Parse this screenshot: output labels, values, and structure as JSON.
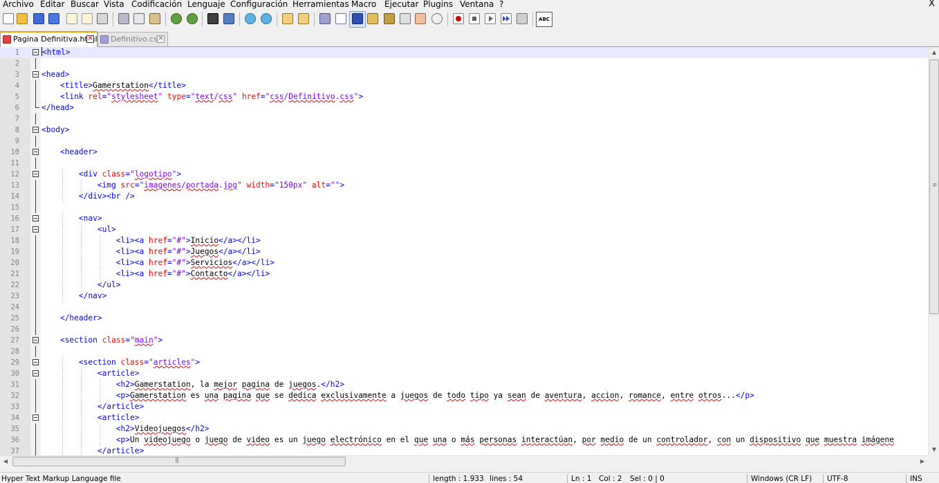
{
  "menu": {
    "items": [
      "Archivo",
      "Editar",
      "Buscar",
      "Vista",
      "Codificación",
      "Lenguaje",
      "Configuración",
      "Herramientas",
      "Macro",
      "Ejecutar",
      "Plugins",
      "Ventana",
      "?"
    ],
    "close_label": "X"
  },
  "toolbar": {
    "buttons": [
      "new-file",
      "open-file",
      "save",
      "save-all",
      "close",
      "close-all",
      "print",
      "cut",
      "copy",
      "paste",
      "undo",
      "redo",
      "find",
      "replace",
      "zoom-in",
      "zoom-out",
      "sync-vertical",
      "sync-horizontal",
      "word-wrap",
      "show-all-chars",
      "indent-guide",
      "user-defined-language",
      "document-map",
      "function-list",
      "folder-as-workspace",
      "monitoring",
      "record-macro",
      "stop-recording",
      "play-macro",
      "run-macro-multiple",
      "save-macro"
    ],
    "spellcheck_label": "ABC"
  },
  "tabs": [
    {
      "label": "Pagina Definitiva.html",
      "active": true
    },
    {
      "label": "Definitivo.css",
      "active": false
    }
  ],
  "editor": {
    "lines": [
      {
        "n": "1",
        "text": "<html>"
      },
      {
        "n": "2",
        "text": ""
      },
      {
        "n": "3",
        "text": "<head>"
      },
      {
        "n": "4",
        "text": "    <title>Gamerstation</title>"
      },
      {
        "n": "5",
        "text": "    <link rel=\"stylesheet\" type=\"text/css\" href=\"css/Definitivo.css\">"
      },
      {
        "n": "6",
        "text": "</head>"
      },
      {
        "n": "7",
        "text": ""
      },
      {
        "n": "8",
        "text": "<body>"
      },
      {
        "n": "9",
        "text": ""
      },
      {
        "n": "10",
        "text": "    <header>"
      },
      {
        "n": "11",
        "text": ""
      },
      {
        "n": "12",
        "text": "        <div class=\"logotipo\">"
      },
      {
        "n": "13",
        "text": "            <img src=\"imagenes/portada.jpg\" width=\"150px\" alt=\"\">"
      },
      {
        "n": "14",
        "text": "        </div><br />"
      },
      {
        "n": "15",
        "text": ""
      },
      {
        "n": "16",
        "text": "        <nav>"
      },
      {
        "n": "17",
        "text": "            <ul>"
      },
      {
        "n": "18",
        "text": "                <li><a href=\"#\">Inicio</a></li>"
      },
      {
        "n": "19",
        "text": "                <li><a href=\"#\">Juegos</a></li>"
      },
      {
        "n": "20",
        "text": "                <li><a href=\"#\">Servicios</a></li>"
      },
      {
        "n": "21",
        "text": "                <li><a href=\"#\">Contacto</a></li>"
      },
      {
        "n": "22",
        "text": "            </ul>"
      },
      {
        "n": "23",
        "text": "        </nav>"
      },
      {
        "n": "24",
        "text": ""
      },
      {
        "n": "25",
        "text": "    </header>"
      },
      {
        "n": "26",
        "text": ""
      },
      {
        "n": "27",
        "text": "    <section class=\"main\">"
      },
      {
        "n": "28",
        "text": ""
      },
      {
        "n": "29",
        "text": "        <section class=\"articles\">"
      },
      {
        "n": "30",
        "text": "            <article>"
      },
      {
        "n": "31",
        "text": "                <h2>Gamerstation, la mejor pagina de juegos.</h2>"
      },
      {
        "n": "32",
        "text": "                <p>Gamerstation es una pagina que se dedica exclusivamente a juegos de todo tipo ya sean de aventura, accion, romance, entre otros...</p>"
      },
      {
        "n": "33",
        "text": "            </article>"
      },
      {
        "n": "34",
        "text": "            <article>"
      },
      {
        "n": "35",
        "text": "                <h2>Videojuegos</h2>"
      },
      {
        "n": "36",
        "text": "                <p>Un videojuego o juego de video es un juego electrónico en el que una o más personas interactúan, por medio de un controlador, con un dispositivo que muestra imágene"
      },
      {
        "n": "37",
        "text": "            </article>"
      }
    ],
    "current_line": 1
  },
  "status": {
    "file_type": "Hyper Text Markup Language file",
    "length": "length : 1.933",
    "lines": "lines : 54",
    "ln": "Ln : 1",
    "col": "Col : 2",
    "sel": "Sel : 0 | 0",
    "eol": "Windows (CR LF)",
    "encoding": "UTF-8",
    "mode": "INS"
  },
  "colors": {
    "tag": "#0000ff",
    "attribute": "#ff0000",
    "value": "#8000ff",
    "text": "#000000",
    "current_line_bg": "#e8e8ff",
    "fold_marker": "#c00000",
    "active_tab_accent": "#f0a000"
  }
}
